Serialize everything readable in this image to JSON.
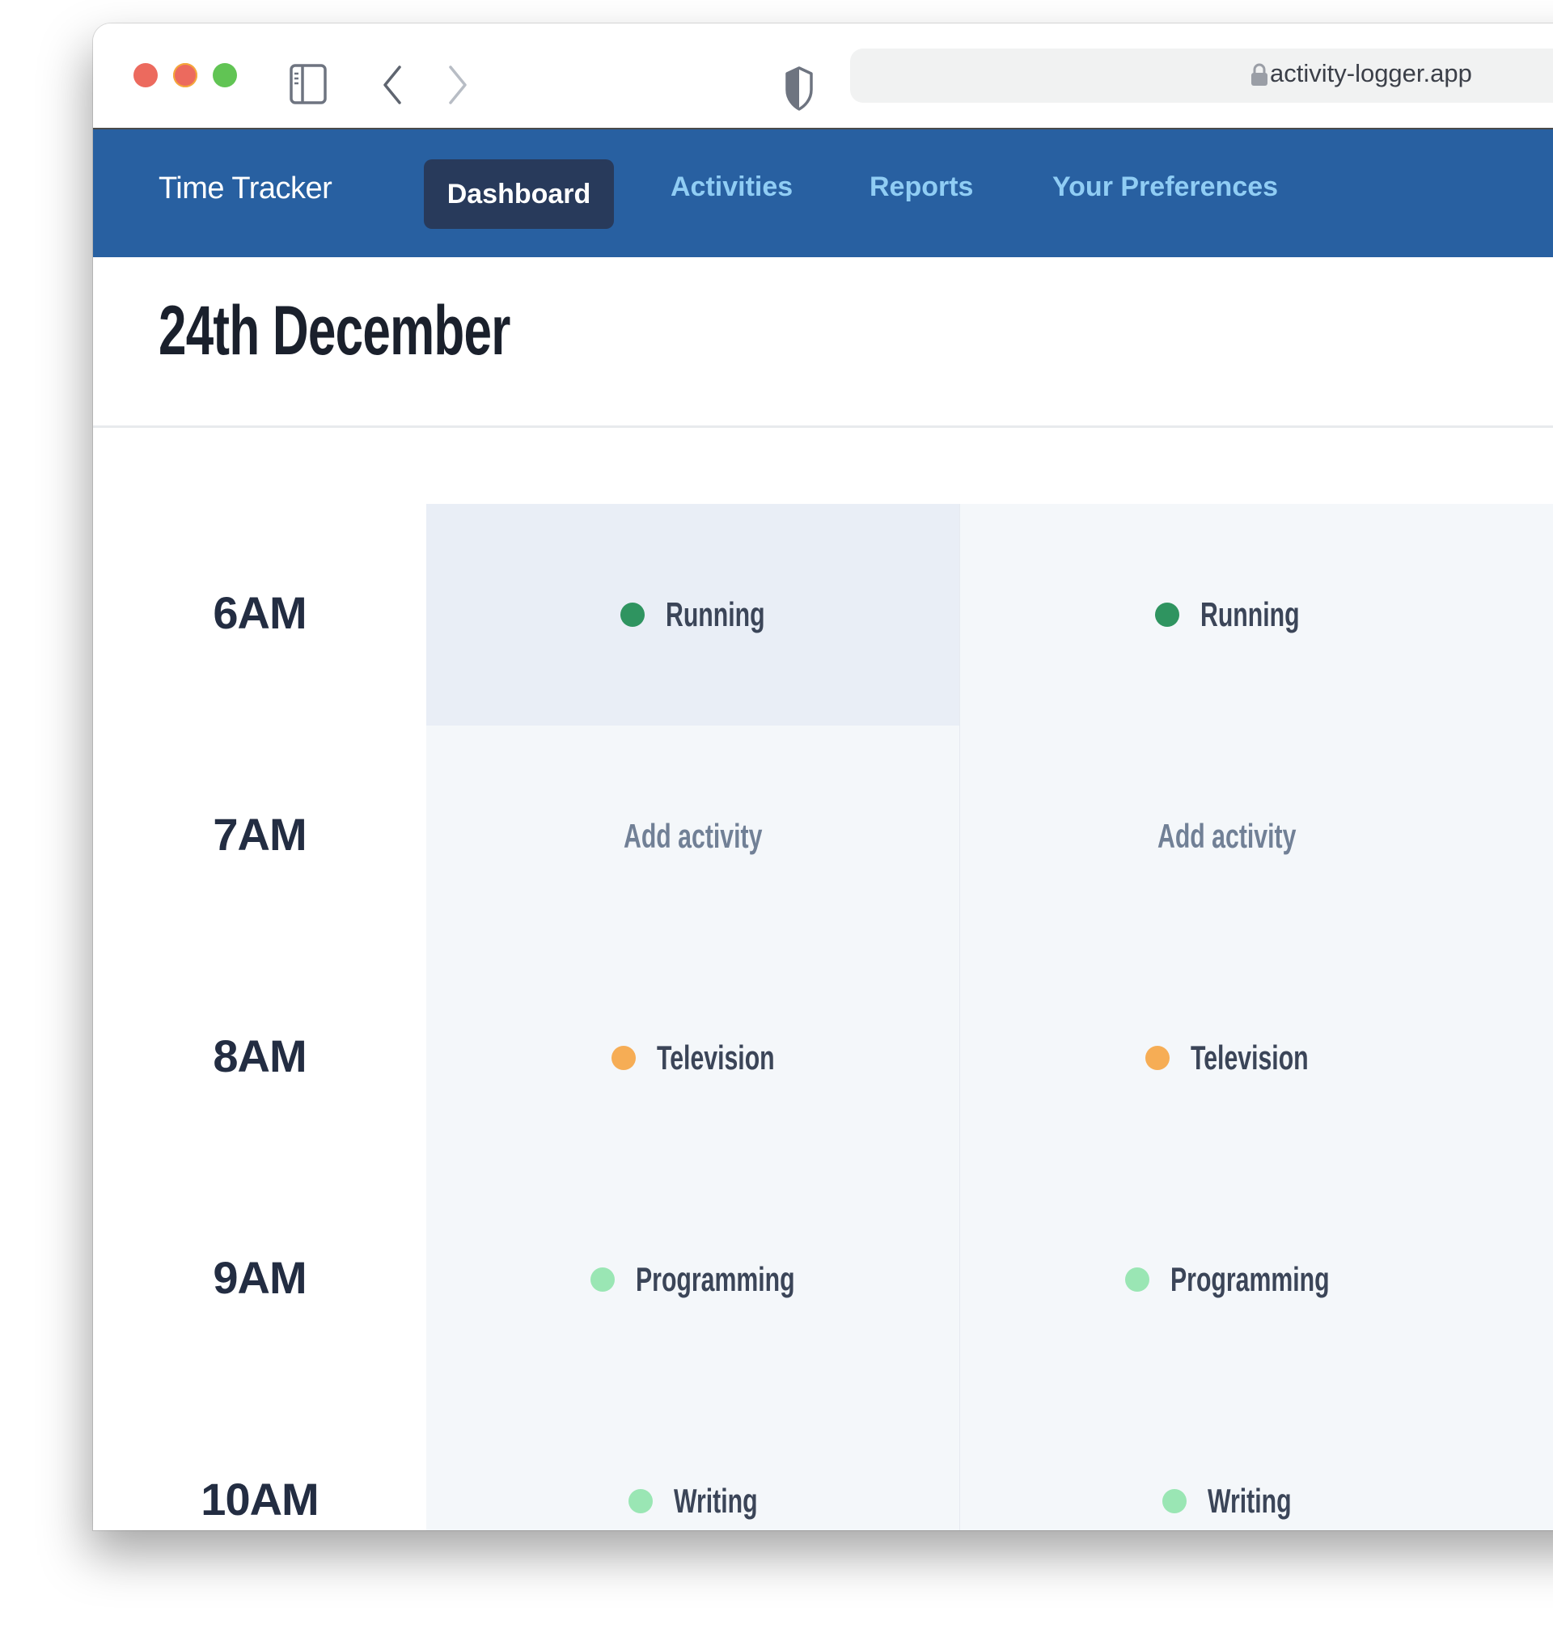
{
  "browser": {
    "url": "activity-logger.app",
    "icons": [
      "sidebar-icon",
      "back-icon",
      "forward-icon",
      "shield-icon",
      "lock-icon"
    ]
  },
  "nav": {
    "brand": "Time Tracker",
    "links": [
      {
        "label": "Dashboard",
        "active": true
      },
      {
        "label": "Activities",
        "active": false
      },
      {
        "label": "Reports",
        "active": false
      },
      {
        "label": "Your Preferences",
        "active": false
      }
    ]
  },
  "page": {
    "title": "24th December"
  },
  "colors": {
    "nav_bg": "#2860a1",
    "nav_active_bg": "#283a5b",
    "nav_link": "#90cdf4",
    "running": "#2f9460",
    "television": "#f6ad55",
    "programming": "#9ae6b4",
    "writing": "#9ae6b4"
  },
  "schedule": {
    "rows": [
      {
        "time": "6AM",
        "cells": [
          {
            "label": "Running",
            "color": "#2f9460",
            "empty": false,
            "selected": true
          },
          {
            "label": "Running",
            "color": "#2f9460",
            "empty": false,
            "selected": false
          }
        ]
      },
      {
        "time": "7AM",
        "cells": [
          {
            "label": "Add activity",
            "color": null,
            "empty": true,
            "selected": false
          },
          {
            "label": "Add activity",
            "color": null,
            "empty": true,
            "selected": false
          }
        ]
      },
      {
        "time": "8AM",
        "cells": [
          {
            "label": "Television",
            "color": "#f6ad55",
            "empty": false,
            "selected": false
          },
          {
            "label": "Television",
            "color": "#f6ad55",
            "empty": false,
            "selected": false
          }
        ]
      },
      {
        "time": "9AM",
        "cells": [
          {
            "label": "Programming",
            "color": "#9ae6b4",
            "empty": false,
            "selected": false
          },
          {
            "label": "Programming",
            "color": "#9ae6b4",
            "empty": false,
            "selected": false
          }
        ]
      },
      {
        "time": "10AM",
        "cells": [
          {
            "label": "Writing",
            "color": "#9ae6b4",
            "empty": false,
            "selected": false
          },
          {
            "label": "Writing",
            "color": "#9ae6b4",
            "empty": false,
            "selected": false
          }
        ]
      }
    ]
  }
}
